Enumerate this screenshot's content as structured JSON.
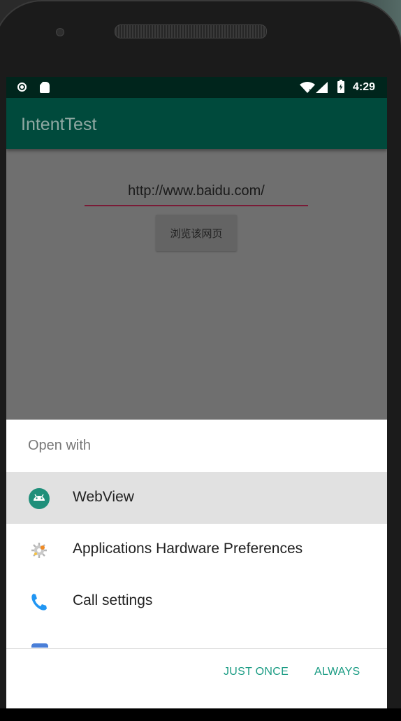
{
  "status_bar": {
    "time": "4:29",
    "icons": [
      "notification-dot-icon",
      "sd-card-icon",
      "wifi-icon",
      "signal-icon",
      "battery-charging-icon"
    ]
  },
  "app_bar": {
    "title": "IntentTest"
  },
  "main": {
    "url_value": "http://www.baidu.com/",
    "browse_button_label": "浏览该网页"
  },
  "chooser": {
    "title": "Open with",
    "options": [
      {
        "label": "WebView",
        "icon": "android-webview-icon",
        "selected": true
      },
      {
        "label": "Applications Hardware Preferences",
        "icon": "gear-sparkle-icon",
        "selected": false
      },
      {
        "label": "Call settings",
        "icon": "phone-icon",
        "selected": false
      }
    ],
    "actions": {
      "just_once": "JUST ONCE",
      "always": "ALWAYS"
    }
  },
  "colors": {
    "status_bar": "#00251c",
    "app_bar": "#004a3c",
    "accent": "#1b9c84",
    "input_underline": "#7a1a36"
  }
}
